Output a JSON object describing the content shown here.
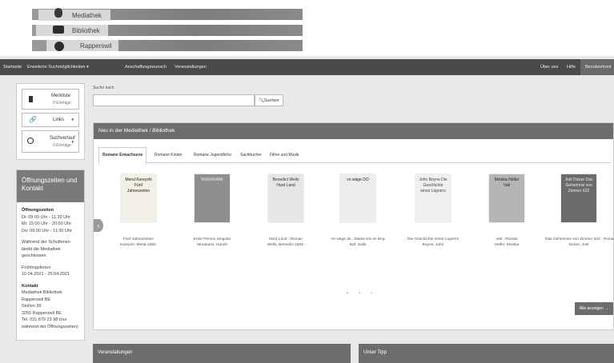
{
  "logo": {
    "line1": "Mediathek",
    "line2": "Bibliothek",
    "line3": "Rapperswil"
  },
  "nav": {
    "items": [
      "Startseite",
      "Erweiterte Suchmöglichkeiten ▾",
      "Anschaffungswunsch",
      "Veranstaltungen"
    ],
    "right": [
      "Über uns",
      "Hilfe",
      "Benutzerkont"
    ]
  },
  "sidebar": {
    "watchlist": {
      "title": "Merkliste",
      "count": "0 Einträge"
    },
    "links": {
      "title": "Links",
      "caret": "▾"
    },
    "history": {
      "title": "Suchverlauf",
      "count": "0 Einträge",
      "caret": "▾"
    },
    "hours_title": "Öffnungszeiten und Kontakt",
    "hours": {
      "heading": "Öffnungszeiten",
      "l1": "Di: 09:00 Uhr - 11:30 Uhr",
      "l2": "Mi: 15:00 Uhr - 20:00 Uhr",
      "l3": "Do: 09:00 Uhr - 11:30 Uhr",
      "p2": "Während der Schulferien bleibt die Mediathek geschlossen",
      "p3a": "Frühlingsferien",
      "p3b": "10.04.2021 - 25.04.2021",
      "contact_head": "Kontakt",
      "c1": "Mediathek Bibliothek",
      "c2": "Rapperswil BE",
      "c3": "Stollen 39",
      "c4": "3255 Rapperswil BE",
      "c5": "Tel. 031 879 23 98 (nur",
      "c6": "während der Öffnungszeiten)"
    }
  },
  "search": {
    "label": "Suche nach",
    "value": "",
    "button": "Suchen"
  },
  "new_panel": {
    "title": "Neu in der Mediathek / Bibliothek",
    "tabs": [
      "Romane Erwachsene",
      "Romane Kinder",
      "Romane Jugendliche",
      "Sachbücher",
      "Filme und Musik"
    ],
    "books": [
      {
        "cap1": "Fünf Jahreszeiten",
        "cap2": "Kareyeh, Meral 1983-",
        "cover_title": "Meral Kureyshi Fünf Jahreszeiten",
        "bg": "#f2efe6",
        "fg": "#222"
      },
      {
        "cap1": "Erste Person Singular",
        "cap2": "Murakami, Haruki",
        "cover_title": "MURAKAMI",
        "bg": "#8f8f8f",
        "fg": "#eee"
      },
      {
        "cap1": "Nord Land : Roman",
        "cap2": "Wells, Benedict 1984-",
        "cover_title": "Benedict Wells Hard Land",
        "bg": "#e6e6e6",
        "fg": "#333"
      },
      {
        "cap1": "Vo wäge do : lisstes isis es king",
        "cap2": "Näf, Salis",
        "cover_title": "vo wäge DO",
        "bg": "#ededed",
        "fg": "#222"
      },
      {
        "cap1": "Die Geschichte eines Lügners",
        "cap2": "Boyne, John",
        "cover_title": "John Boyne Die Geschichte eines Lügners",
        "bg": "#efefef",
        "fg": "#444"
      },
      {
        "cap1": "Vati : Roman",
        "cap2": "Helfer, Monika",
        "cover_title": "Monika Helfer Vati",
        "bg": "#b5b5b5",
        "fg": "#222"
      },
      {
        "cap1": "Das Geheimnis von Zimmer 622 : Roman",
        "cap2": "Dicker, Joël",
        "cover_title": "Joël Dicker Das Geheimnis von Zimmer 622",
        "bg": "#6b6b6b",
        "fg": "#eee"
      }
    ],
    "dots": "• • •",
    "more": "Alle anzeigen →"
  },
  "bottom": {
    "left": "Veranstaltungen",
    "right": "Unser Tipp"
  }
}
